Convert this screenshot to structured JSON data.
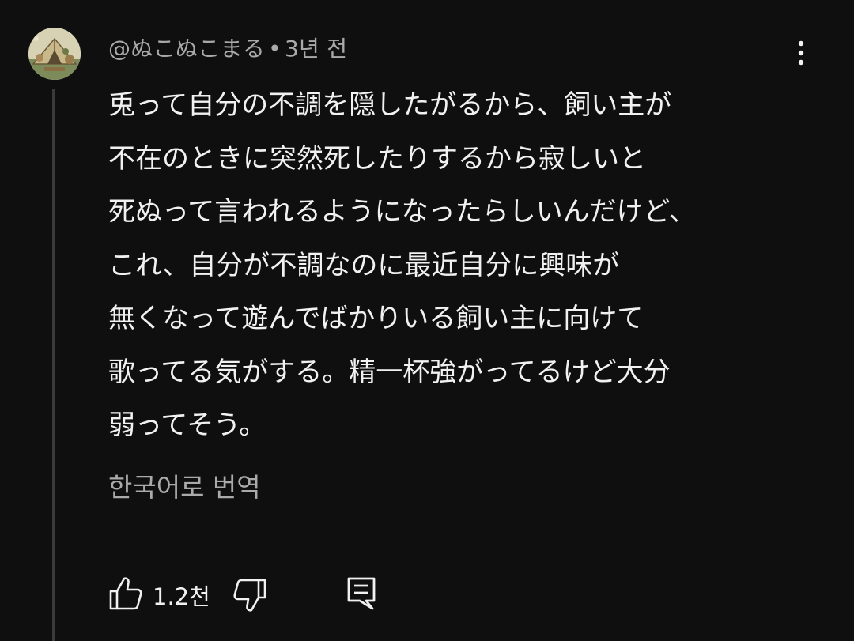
{
  "comment": {
    "author": "@ぬこぬこまる",
    "separator": "•",
    "timestamp": "3년 전",
    "lines": [
      "兎って自分の不調を隠したがるから、飼い主が",
      "不在のときに突然死したりするから寂しいと",
      "死ぬって言われるようになったらしいんだけど、",
      "これ、自分が不調なのに最近自分に興味が",
      "無くなって遊んでばかりいる飼い主に向けて",
      "歌ってる気がする。精一杯強がってるけど大分",
      "弱ってそう。"
    ],
    "translate_label": "한국어로 번역",
    "like_count": "1.2천"
  },
  "icons": {
    "avatar": "user-avatar-illustration",
    "menu": "more-vertical-icon",
    "like": "thumbs-up-icon",
    "dislike": "thumbs-down-icon",
    "reply": "comment-reply-icon"
  },
  "colors": {
    "background": "#0f0f0f",
    "primary_text": "#f1f1f1",
    "secondary_text": "#aaaaaa",
    "thread_line": "#3a3a3a"
  }
}
